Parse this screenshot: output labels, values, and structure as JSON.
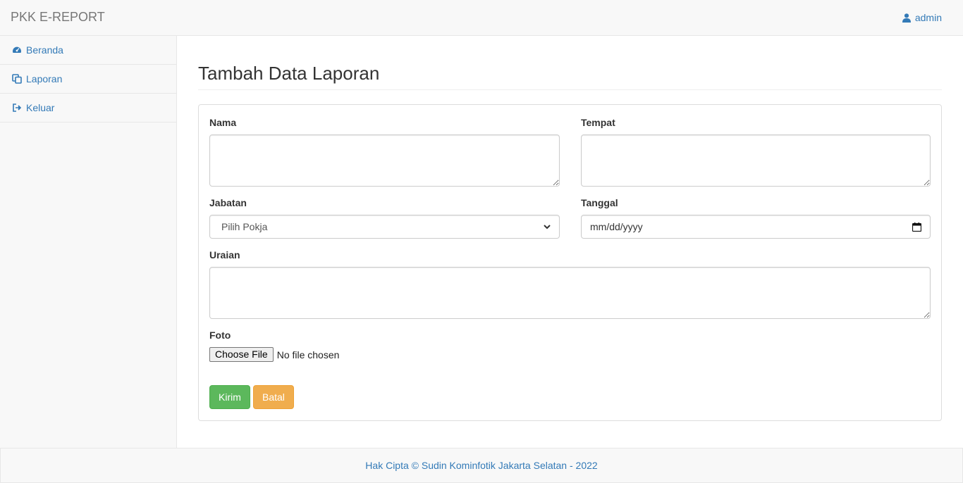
{
  "header": {
    "brand": "PKK E-REPORT",
    "user": "admin"
  },
  "sidebar": {
    "items": [
      {
        "label": "Beranda",
        "icon": "dashboard-icon"
      },
      {
        "label": "Laporan",
        "icon": "copy-icon"
      },
      {
        "label": "Keluar",
        "icon": "sign-out-icon"
      }
    ]
  },
  "main": {
    "title": "Tambah Data Laporan",
    "form": {
      "nama_label": "Nama",
      "nama_value": "",
      "tempat_label": "Tempat",
      "tempat_value": "",
      "jabatan_label": "Jabatan",
      "jabatan_selected": "Pilih Pokja",
      "tanggal_label": "Tanggal",
      "tanggal_placeholder": "mm/dd/yyyy",
      "uraian_label": "Uraian",
      "uraian_value": "",
      "foto_label": "Foto",
      "file_button": "Choose File",
      "file_status": "No file chosen",
      "submit_label": "Kirim",
      "cancel_label": "Batal"
    }
  },
  "footer": {
    "text": "Hak Cipta © Sudin Kominfotik Jakarta Selatan - 2022"
  },
  "colors": {
    "link": "#337ab7",
    "success": "#5cb85c",
    "warning": "#f0ad4e",
    "navbar_bg": "#f8f8f8"
  }
}
